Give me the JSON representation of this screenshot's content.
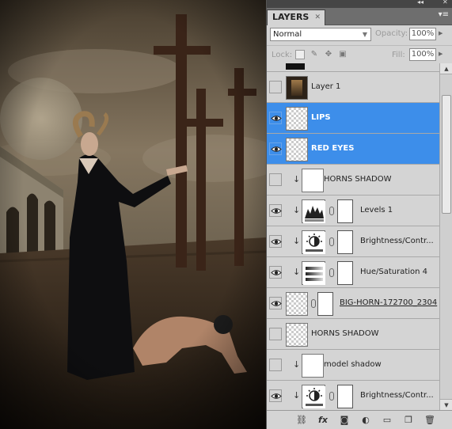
{
  "panel": {
    "collapse_glyph": "◂◂",
    "close_glyph": "✕",
    "tab_label": "LAYERS",
    "tab_close": "✕",
    "menu_glyph": "▾≡",
    "blend_mode": "Normal",
    "opacity_label": "Opacity:",
    "opacity_value": "100%",
    "lock_label": "Lock:",
    "fill_label": "Fill:",
    "fill_value": "100%"
  },
  "lock_icons": [
    "lock-transparent-icon",
    "lock-brush-icon",
    "lock-move-icon",
    "lock-all-icon"
  ],
  "layers": [
    {
      "name": "Layer 1",
      "visible": false,
      "selected": false,
      "clipped": false,
      "type": "photo"
    },
    {
      "name": "LIPS",
      "visible": true,
      "selected": true,
      "clipped": false,
      "type": "transparent"
    },
    {
      "name": "RED EYES",
      "visible": true,
      "selected": true,
      "clipped": false,
      "type": "transparent"
    },
    {
      "name": "HORNS SHADOW",
      "visible": false,
      "selected": false,
      "clipped": true,
      "type": "white"
    },
    {
      "name": "Levels 1",
      "visible": true,
      "selected": false,
      "clipped": true,
      "type": "levels"
    },
    {
      "name": "Brightness/Contr...",
      "visible": true,
      "selected": false,
      "clipped": true,
      "type": "brightness"
    },
    {
      "name": "Hue/Saturation 4",
      "visible": true,
      "selected": false,
      "clipped": true,
      "type": "huesat"
    },
    {
      "name": "BIG-HORN-172700_2304",
      "visible": true,
      "selected": false,
      "clipped": false,
      "type": "smart"
    },
    {
      "name": "HORNS SHADOW",
      "visible": false,
      "selected": false,
      "clipped": false,
      "type": "transparent"
    },
    {
      "name": "model shadow",
      "visible": false,
      "selected": false,
      "clipped": true,
      "type": "white"
    },
    {
      "name": "Brightness/Contr...",
      "visible": true,
      "selected": false,
      "clipped": true,
      "type": "brightness"
    }
  ],
  "bottom_icons": [
    "link-layers-icon",
    "fx-icon",
    "add-mask-icon",
    "adjustment-layer-icon",
    "new-group-icon",
    "new-layer-icon",
    "delete-layer-icon"
  ],
  "colors": {
    "selection": "#3d8eea",
    "panel_bg": "#d4d4d4"
  }
}
